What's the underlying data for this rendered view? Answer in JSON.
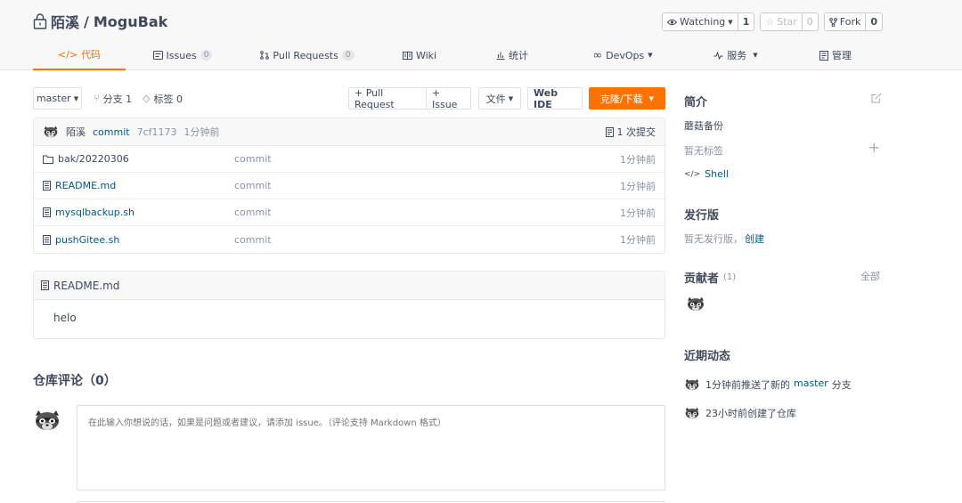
{
  "repo": {
    "owner": "陌溪",
    "separator": "/",
    "name": "MoguBak"
  },
  "actions": {
    "watching": {
      "label": "Watching",
      "count": "1"
    },
    "star": {
      "label": "Star",
      "count": "0"
    },
    "fork": {
      "label": "Fork",
      "count": "0"
    }
  },
  "tabs": [
    {
      "icon": "</>",
      "label": "代码"
    },
    {
      "label": "Issues",
      "badge": "0"
    },
    {
      "label": "Pull Requests",
      "badge": "0"
    },
    {
      "label": "Wiki"
    },
    {
      "label": "统计"
    },
    {
      "label": "DevOps"
    },
    {
      "label": "服务"
    },
    {
      "label": "管理"
    }
  ],
  "toolbar": {
    "branch": "master",
    "branches": "分支 1",
    "tags": "标签 0",
    "pull_request": "+ Pull Request",
    "issue": "+ Issue",
    "files": "文件",
    "web_ide": "Web IDE",
    "clone": "克隆/下载"
  },
  "commit": {
    "author": "陌溪",
    "message": "commit",
    "hash": "7cf1173",
    "time": "1分钟前",
    "count": "1 次提交"
  },
  "files": [
    {
      "name": "bak/20220306",
      "type": "folder",
      "message": "commit",
      "time": "1分钟前"
    },
    {
      "name": "README.md",
      "type": "file",
      "message": "commit",
      "time": "1分钟前"
    },
    {
      "name": "mysqlbackup.sh",
      "type": "file",
      "message": "commit",
      "time": "1分钟前"
    },
    {
      "name": "pushGitee.sh",
      "type": "file",
      "message": "commit",
      "time": "1分钟前"
    }
  ],
  "readme": {
    "title": "README.md",
    "content": "helo"
  },
  "comments": {
    "title": "仓库评论（0）",
    "placeholder": "在此输入你想说的话，如果是问题或者建议，请添加 issue。（评论支持 Markdown 格式）"
  },
  "sidebar": {
    "intro_title": "简介",
    "description": "蘑菇备份",
    "no_tags": "暂无标签",
    "language": "Shell",
    "release_title": "发行版",
    "no_release": "暂无发行版，",
    "create": "创建",
    "contributors_title": "贡献者",
    "contributors_count": "(1)",
    "all": "全部",
    "activity_title": "近期动态",
    "activities": [
      {
        "pre": "1分钟前推送了新的",
        "link": "master",
        "post": "分支"
      },
      {
        "pre": "23小时前创建了仓库",
        "link": "",
        "post": ""
      }
    ]
  },
  "colors": {
    "accent": "#fe7300",
    "link": "#005980",
    "text": "#40485b",
    "muted": "#8c92a4"
  }
}
